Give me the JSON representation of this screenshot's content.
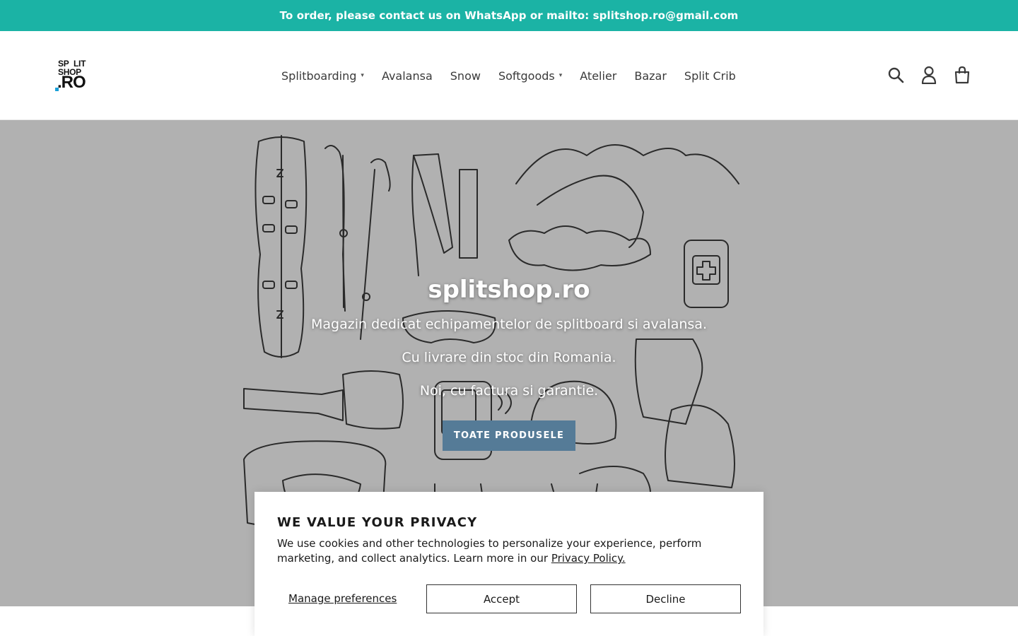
{
  "announcement": {
    "text": "To order, please contact us on WhatsApp or mailto: splitshop.ro@gmail.com"
  },
  "logo": {
    "line1a": "SP",
    "line1b": "LIT",
    "line2": "SHOP",
    "line3": ".RO",
    "accent_color": "#1aa0d8"
  },
  "nav": {
    "items": [
      {
        "label": "Splitboarding",
        "has_dropdown": true
      },
      {
        "label": "Avalansa",
        "has_dropdown": false
      },
      {
        "label": "Snow",
        "has_dropdown": false
      },
      {
        "label": "Softgoods",
        "has_dropdown": true
      },
      {
        "label": "Atelier",
        "has_dropdown": false
      },
      {
        "label": "Bazar",
        "has_dropdown": false
      },
      {
        "label": "Split Crib",
        "has_dropdown": false
      }
    ]
  },
  "header_icons": [
    "search-icon",
    "account-icon",
    "cart-icon"
  ],
  "hero": {
    "title": "splitshop.ro",
    "lines": [
      "Magazin dedicat echipamentelor de splitboard si avalansa.",
      "Cu livrare din stoc din Romania.",
      "Noi, cu factura si garantie."
    ],
    "button_label": "TOATE PRODUSELE"
  },
  "cookie": {
    "title": "WE VALUE YOUR PRIVACY",
    "text": "We use cookies and other technologies to personalize your experience, perform marketing, and collect analytics. Learn more in our",
    "link": "Privacy Policy.",
    "manage": "Manage preferences",
    "accept": "Accept",
    "decline": "Decline"
  },
  "colors": {
    "announcement_bg": "#1bb3a5",
    "hero_bg": "#b1b1b1",
    "button_bg": "#557b97"
  }
}
